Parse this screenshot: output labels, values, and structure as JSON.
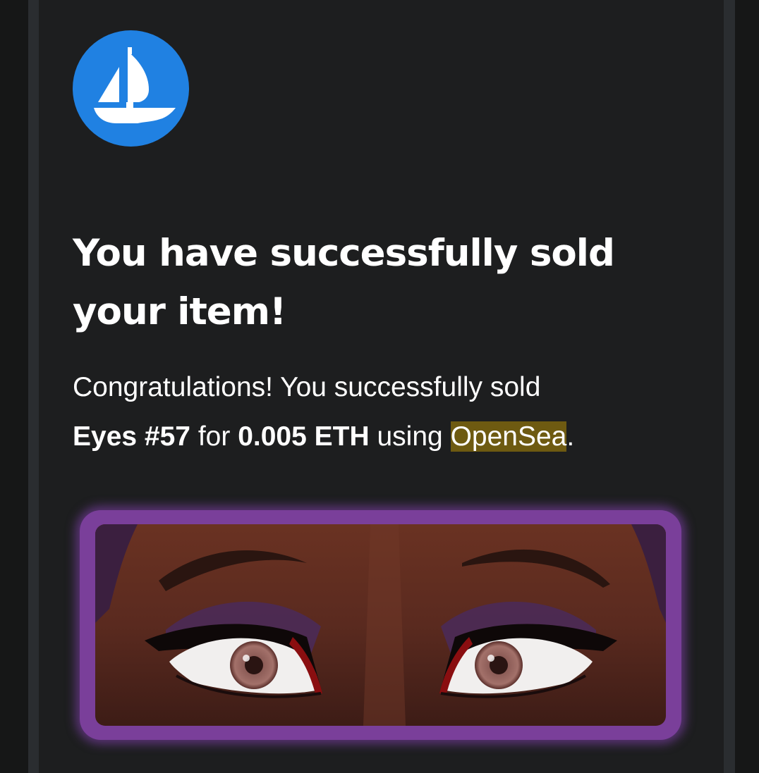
{
  "app": {
    "logo_icon": "opensea-ship-logo",
    "brand_color": "#2081e2"
  },
  "email": {
    "headline": "You have successfully sold your item!",
    "intro": "Congratulations! You successfully sold",
    "item_name": "Eyes #57",
    "connector_for": "for",
    "price": "0.005 ETH",
    "connector_using": "using",
    "platform": "OpenSea",
    "ending": ".",
    "highlight_color": "#6e5a11"
  },
  "nft_image": {
    "icon": "nft-eyes-artwork",
    "frame_color": "#7a3f9a"
  }
}
